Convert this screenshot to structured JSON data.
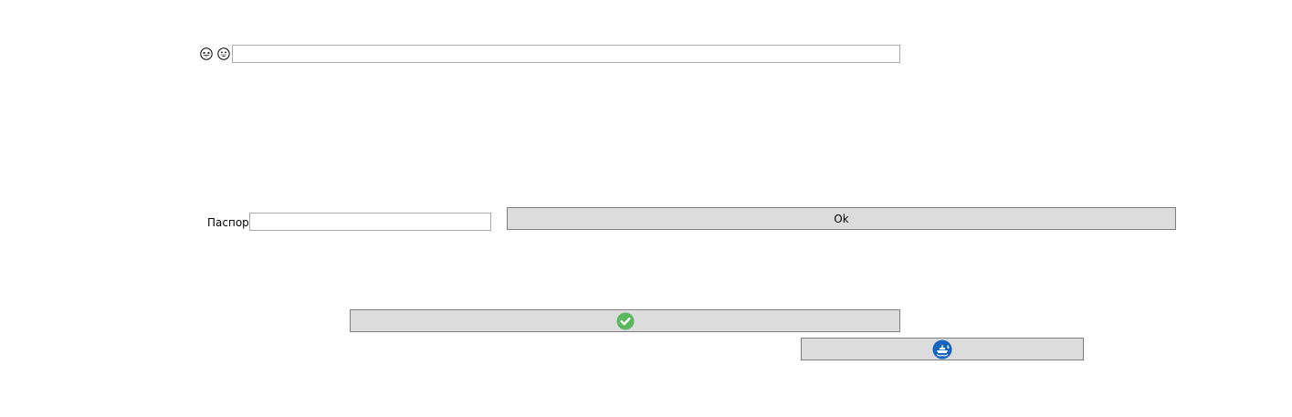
{
  "top_row": {
    "icons": [
      "grin-squint-emoji-icon",
      "grin-emoji-icon"
    ],
    "text_value": ""
  },
  "passport": {
    "label": "Паспорт",
    "value": ""
  },
  "buttons": {
    "ok_label": "Ok",
    "confirm_icon": "check-circle-icon",
    "refresh_icon": "ship-refresh-icon"
  },
  "colors": {
    "button_bg": "#dcdcdc",
    "button_border": "#808080",
    "input_border": "#a9a9a9",
    "check_green": "#5cb85c",
    "refresh_blue": "#1565c0"
  }
}
